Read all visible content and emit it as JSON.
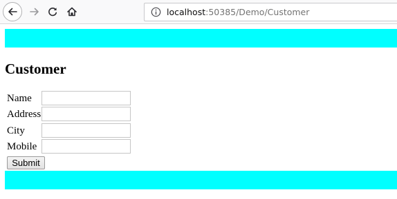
{
  "browser": {
    "url_host": "localhost",
    "url_path": ":50385/Demo/Customer",
    "icons": {
      "back": "back-arrow-icon",
      "forward": "forward-arrow-icon",
      "reload": "reload-icon",
      "home": "home-icon",
      "info": "info-icon"
    }
  },
  "page": {
    "title": "Customer",
    "band_color": "#00ffff",
    "fields": [
      {
        "label": "Name",
        "value": ""
      },
      {
        "label": "Address",
        "value": ""
      },
      {
        "label": "City",
        "value": ""
      },
      {
        "label": "Mobile",
        "value": ""
      }
    ],
    "submit_label": "Submit"
  }
}
